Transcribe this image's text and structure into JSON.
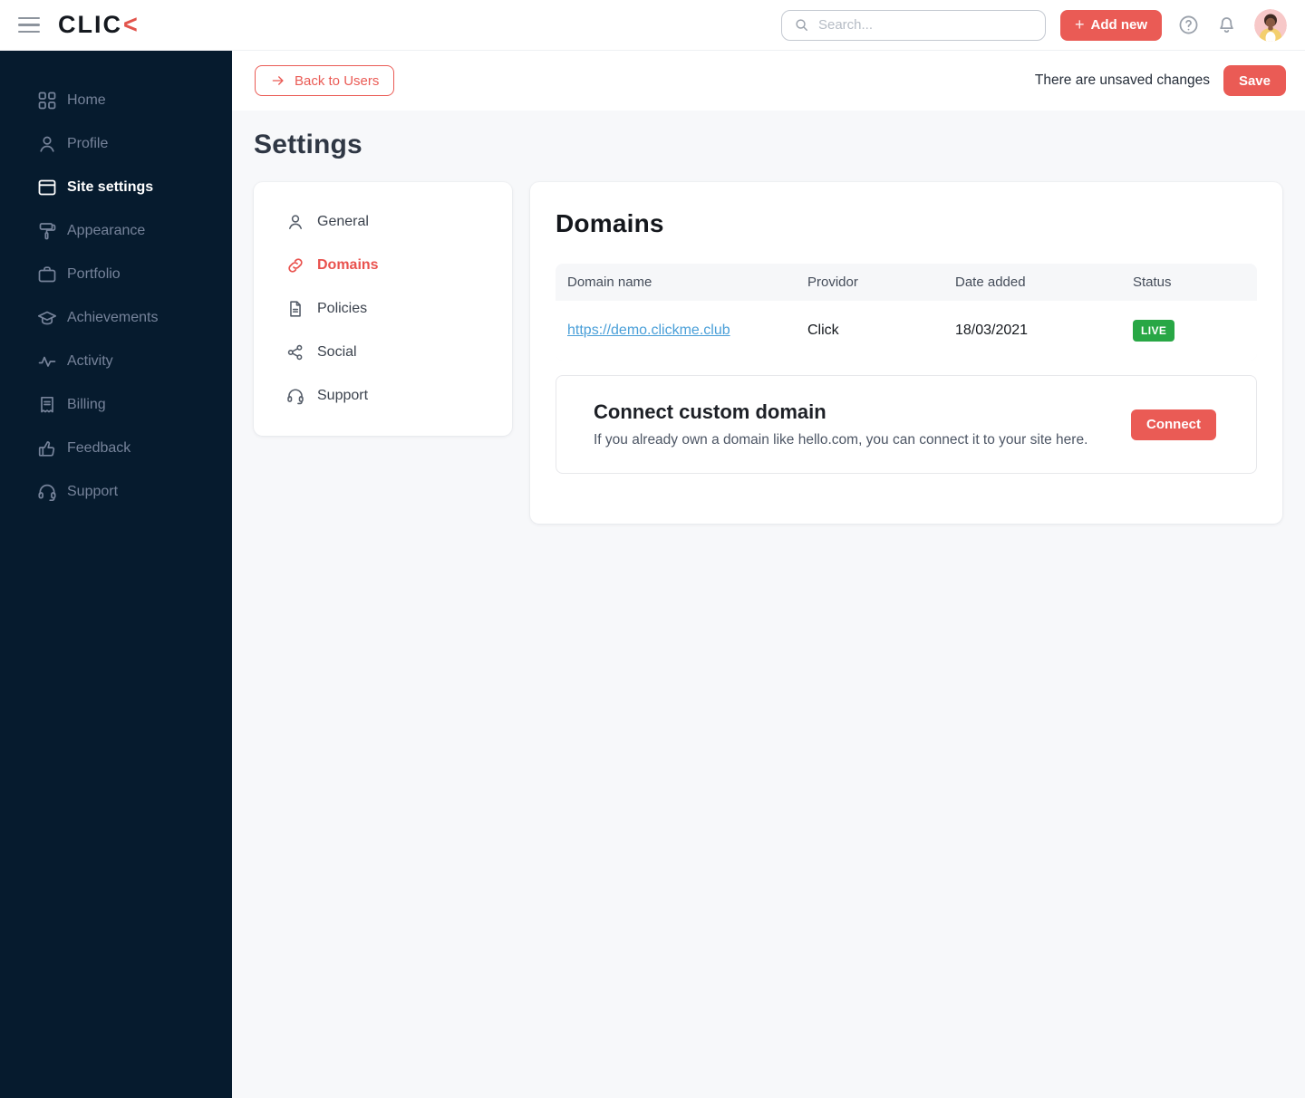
{
  "header": {
    "logo_text": "CLIC",
    "logo_chevron": "<",
    "search_placeholder": "Search...",
    "add_new_label": "Add new",
    "plus_glyph": "+"
  },
  "sidebar": {
    "items": [
      {
        "label": "Home",
        "icon": "grid-icon",
        "active": false
      },
      {
        "label": "Profile",
        "icon": "user-icon",
        "active": false
      },
      {
        "label": "Site settings",
        "icon": "browser-window-icon",
        "active": true
      },
      {
        "label": "Appearance",
        "icon": "paint-roller-icon",
        "active": false
      },
      {
        "label": "Portfolio",
        "icon": "briefcase-icon",
        "active": false
      },
      {
        "label": "Achievements",
        "icon": "graduation-cap-icon",
        "active": false
      },
      {
        "label": "Activity",
        "icon": "activity-pulse-icon",
        "active": false
      },
      {
        "label": "Billing",
        "icon": "receipt-icon",
        "active": false
      },
      {
        "label": "Feedback",
        "icon": "thumbs-up-icon",
        "active": false
      },
      {
        "label": "Support",
        "icon": "headset-icon",
        "active": false
      }
    ]
  },
  "actionbar": {
    "back_label": "Back to Users",
    "unsaved_text": "There are unsaved changes",
    "save_label": "Save"
  },
  "page": {
    "title": "Settings"
  },
  "settings_nav": {
    "items": [
      {
        "label": "General",
        "icon": "user-icon",
        "active": false
      },
      {
        "label": "Domains",
        "icon": "link-icon",
        "active": true
      },
      {
        "label": "Policies",
        "icon": "document-icon",
        "active": false
      },
      {
        "label": "Social",
        "icon": "share-icon",
        "active": false
      },
      {
        "label": "Support",
        "icon": "headset-icon",
        "active": false
      }
    ]
  },
  "domains": {
    "title": "Domains",
    "table": {
      "columns": [
        "Domain name",
        "Providor",
        "Date added",
        "Status"
      ],
      "rows": [
        {
          "domain": "https://demo.clickme.club",
          "provider": "Click",
          "date": "18/03/2021",
          "status": "LIVE"
        }
      ]
    },
    "connect": {
      "title": "Connect custom domain",
      "description": "If you already own a domain like hello.com, you can connect it to your site here.",
      "button_label": "Connect"
    }
  },
  "colors": {
    "accent_red": "#ea5b55",
    "live_green": "#28a745",
    "link_blue": "#4a9fd8",
    "sidebar_navy": "#061b2e"
  }
}
